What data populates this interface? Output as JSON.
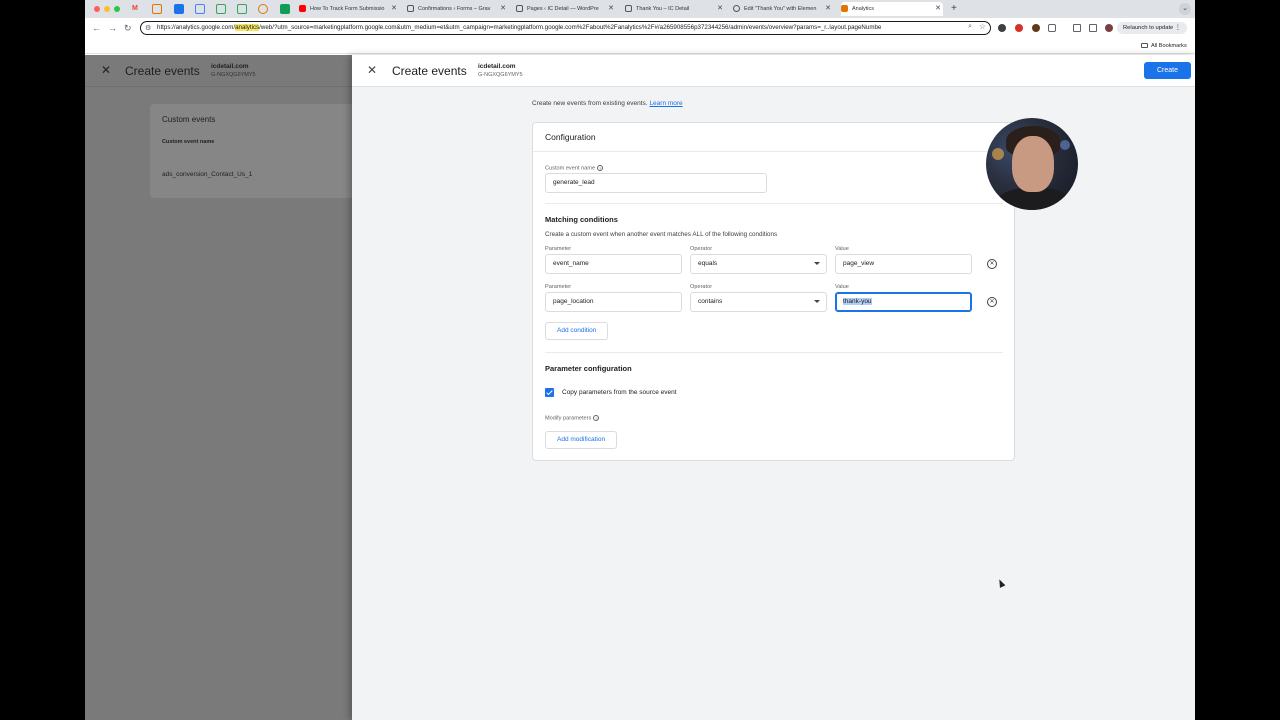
{
  "browser": {
    "tabs": [
      {
        "label": "M",
        "color": "#ea4335"
      },
      {
        "label": "",
        "color": "#e37400"
      },
      {
        "label": "",
        "color": "#1a73e8"
      },
      {
        "label": "",
        "color": "#4285f4"
      },
      {
        "label": "",
        "color": "#34a853"
      },
      {
        "label": "",
        "color": "#34a853"
      },
      {
        "label": "",
        "color": "#e8710a"
      },
      {
        "label": "",
        "color": "#0f9d58"
      },
      {
        "title": "How To Track Form Submissio",
        "favicon": "youtube-icon",
        "color": "#ff0000"
      },
      {
        "title": "Confirmations ‹ Forms – Grav",
        "favicon": "wordpress-icon",
        "color": "#555555"
      },
      {
        "title": "Pages ‹ IC Detail — WordPre",
        "favicon": "wordpress-icon",
        "color": "#555555"
      },
      {
        "title": "Thank You – IC Detail",
        "favicon": "wordpress-icon",
        "color": "#555555"
      },
      {
        "title": "Edit \"Thank You\" with Elemen",
        "favicon": "elementor-icon",
        "color": "#555555"
      },
      {
        "title": "Analytics",
        "favicon": "analytics-icon",
        "color": "#e37400"
      }
    ],
    "url_prefix": "https://analytics.google.com/",
    "url_highlight": "analytics",
    "url_suffix": "/web/?utm_source=marketingplatform.google.com&utm_medium=et&utm_campaign=marketingplatform.google.com%2Fabout%2Fanalytics%2F#/a265908556p372344256/admin/events/overview?params=_r..layout.pageNumbe",
    "relaunch_label": "Relaunch to update",
    "all_bookmarks": "All Bookmarks"
  },
  "back_panel": {
    "title": "Create events",
    "site": "icdetail.com",
    "stream_id": "G-NGXQG6YMY5",
    "card_title": "Custom events",
    "column_header": "Custom event name",
    "rows": [
      "ads_conversion_Contact_Us_1"
    ]
  },
  "front_panel": {
    "title": "Create events",
    "site": "icdetail.com",
    "stream_id": "G-NGXQG6YMY5",
    "create_label": "Create",
    "intro_text": "Create new events from existing events.",
    "learn_more": "Learn more",
    "config": {
      "title": "Configuration",
      "custom_event_label": "Custom event name",
      "custom_event_value": "generate_lead",
      "matching_title": "Matching conditions",
      "matching_desc": "Create a custom event when another event matches ALL of the following conditions",
      "param_label": "Parameter",
      "operator_label": "Operator",
      "value_label": "Value",
      "conditions": [
        {
          "parameter": "event_name",
          "operator": "equals",
          "value": "page_view"
        },
        {
          "parameter": "page_location",
          "operator": "contains",
          "value": "thank-you"
        }
      ],
      "add_condition": "Add condition",
      "param_config_title": "Parameter configuration",
      "copy_params_label": "Copy parameters from the source event",
      "copy_params_checked": true,
      "modify_params_label": "Modify parameters",
      "add_modification": "Add modification"
    }
  },
  "colors": {
    "accent": "#1a73e8"
  }
}
